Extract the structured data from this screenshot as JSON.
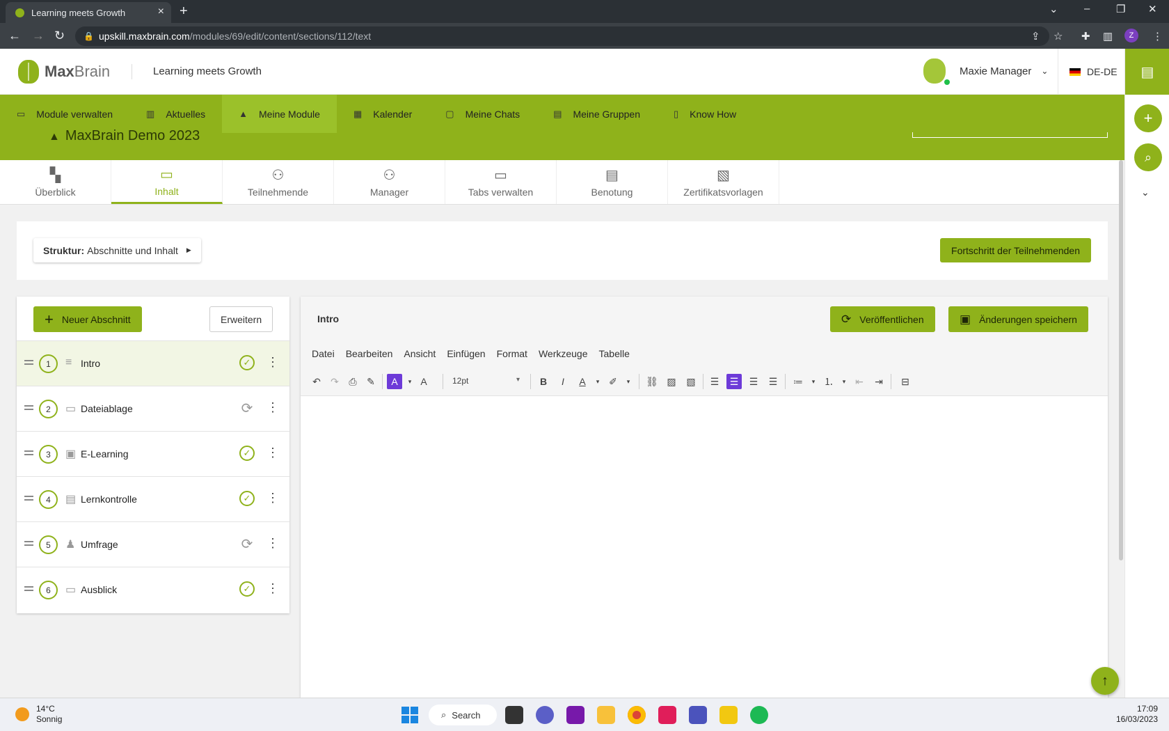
{
  "browser": {
    "tab_title": "Learning meets Growth",
    "url_host": "upskill.maxbrain.com",
    "url_path": "/modules/69/edit/content/sections/112/text",
    "profile_initial": "Z"
  },
  "header": {
    "logo_max": "Max",
    "logo_brain": "Brain",
    "tagline": "Learning meets Growth",
    "user_name": "Maxie Manager",
    "language": "DE-DE"
  },
  "nav": {
    "items": [
      {
        "label": "Module verwalten",
        "icon": "folder-icon"
      },
      {
        "label": "Aktuelles",
        "icon": "news-icon"
      },
      {
        "label": "Meine Module",
        "icon": "graduation-cap-icon"
      },
      {
        "label": "Kalender",
        "icon": "calendar-icon"
      },
      {
        "label": "Meine Chats",
        "icon": "chat-icon"
      },
      {
        "label": "Meine Gruppen",
        "icon": "group-icon"
      },
      {
        "label": "Know How",
        "icon": "book-icon"
      }
    ],
    "active_index": 2,
    "module_title": "MaxBrain Demo 2023"
  },
  "content_tabs": [
    {
      "label": "Überblick",
      "icon": "dashboard-icon"
    },
    {
      "label": "Inhalt",
      "icon": "folder-icon"
    },
    {
      "label": "Teilnehmende",
      "icon": "people-icon"
    },
    {
      "label": "Manager",
      "icon": "manager-icon"
    },
    {
      "label": "Tabs verwalten",
      "icon": "window-icon"
    },
    {
      "label": "Benotung",
      "icon": "grade-icon"
    },
    {
      "label": "Zertifikatsvorlagen",
      "icon": "certificate-icon"
    }
  ],
  "structure": {
    "label": "Struktur:",
    "value": "Abschnitte und Inhalt",
    "progress_button": "Fortschritt der Teilnehmenden"
  },
  "sections": {
    "new_button": "Neuer Abschnitt",
    "expand_button": "Erweitern",
    "items": [
      {
        "number": "1",
        "label": "Intro",
        "icon": "text-icon",
        "status": "published"
      },
      {
        "number": "2",
        "label": "Dateiablage",
        "icon": "folder-icon",
        "status": "sync"
      },
      {
        "number": "3",
        "label": "E-Learning",
        "icon": "monitor-icon",
        "status": "published"
      },
      {
        "number": "4",
        "label": "Lernkontrolle",
        "icon": "quiz-icon",
        "status": "published"
      },
      {
        "number": "5",
        "label": "Umfrage",
        "icon": "survey-icon",
        "status": "sync"
      },
      {
        "number": "6",
        "label": "Ausblick",
        "icon": "folder-icon",
        "status": "published"
      }
    ]
  },
  "editor": {
    "title": "Intro",
    "publish_button": "Veröffentlichen",
    "save_button": "Änderungen speichern",
    "menu": [
      "Datei",
      "Bearbeiten",
      "Ansicht",
      "Einfügen",
      "Format",
      "Werkzeuge",
      "Tabelle"
    ],
    "font_size": "12pt"
  },
  "taskbar": {
    "temperature": "14°C",
    "weather": "Sonnig",
    "search": "Search",
    "time": "17:09",
    "date": "16/03/2023"
  },
  "colors": {
    "brand_green": "#8fb21b",
    "editor_selected": "#6d3ad8"
  }
}
